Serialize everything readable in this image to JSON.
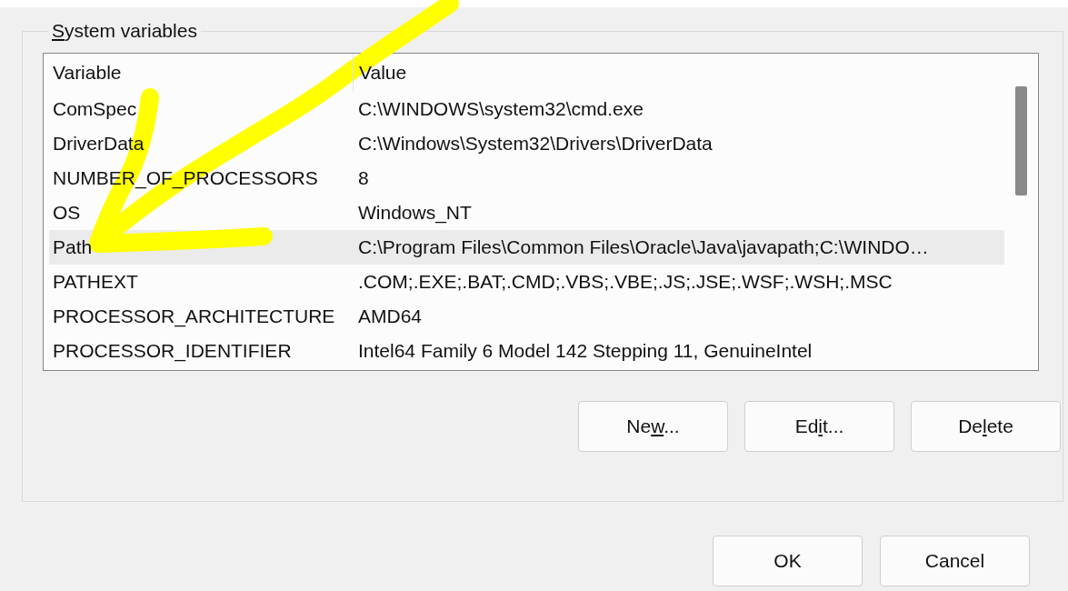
{
  "group": {
    "title": {
      "key": "S",
      "after": "ystem variables"
    },
    "columns": [
      "Variable",
      "Value"
    ],
    "rows": [
      {
        "variable": "ComSpec",
        "value": "C:\\WINDOWS\\system32\\cmd.exe",
        "selected": false
      },
      {
        "variable": "DriverData",
        "value": "C:\\Windows\\System32\\Drivers\\DriverData",
        "selected": false
      },
      {
        "variable": "NUMBER_OF_PROCESSORS",
        "value": "8",
        "selected": false
      },
      {
        "variable": "OS",
        "value": "Windows_NT",
        "selected": false
      },
      {
        "variable": "Path",
        "value": "C:\\Program Files\\Common Files\\Oracle\\Java\\javapath;C:\\WINDO…",
        "selected": true
      },
      {
        "variable": "PATHEXT",
        "value": ".COM;.EXE;.BAT;.CMD;.VBS;.VBE;.JS;.JSE;.WSF;.WSH;.MSC",
        "selected": false
      },
      {
        "variable": "PROCESSOR_ARCHITECTURE",
        "value": "AMD64",
        "selected": false
      },
      {
        "variable": "PROCESSOR_IDENTIFIER",
        "value": "Intel64 Family 6 Model 142 Stepping 11, GenuineIntel",
        "selected": false
      }
    ],
    "buttons": [
      {
        "before": "Ne",
        "key": "w",
        "after": "..."
      },
      {
        "before": "Ed",
        "key": "i",
        "after": "t..."
      },
      {
        "before": "De",
        "key": "l",
        "after": "ete"
      }
    ]
  },
  "dialog_buttons": [
    {
      "before": "OK"
    },
    {
      "before": "Cancel"
    }
  ]
}
